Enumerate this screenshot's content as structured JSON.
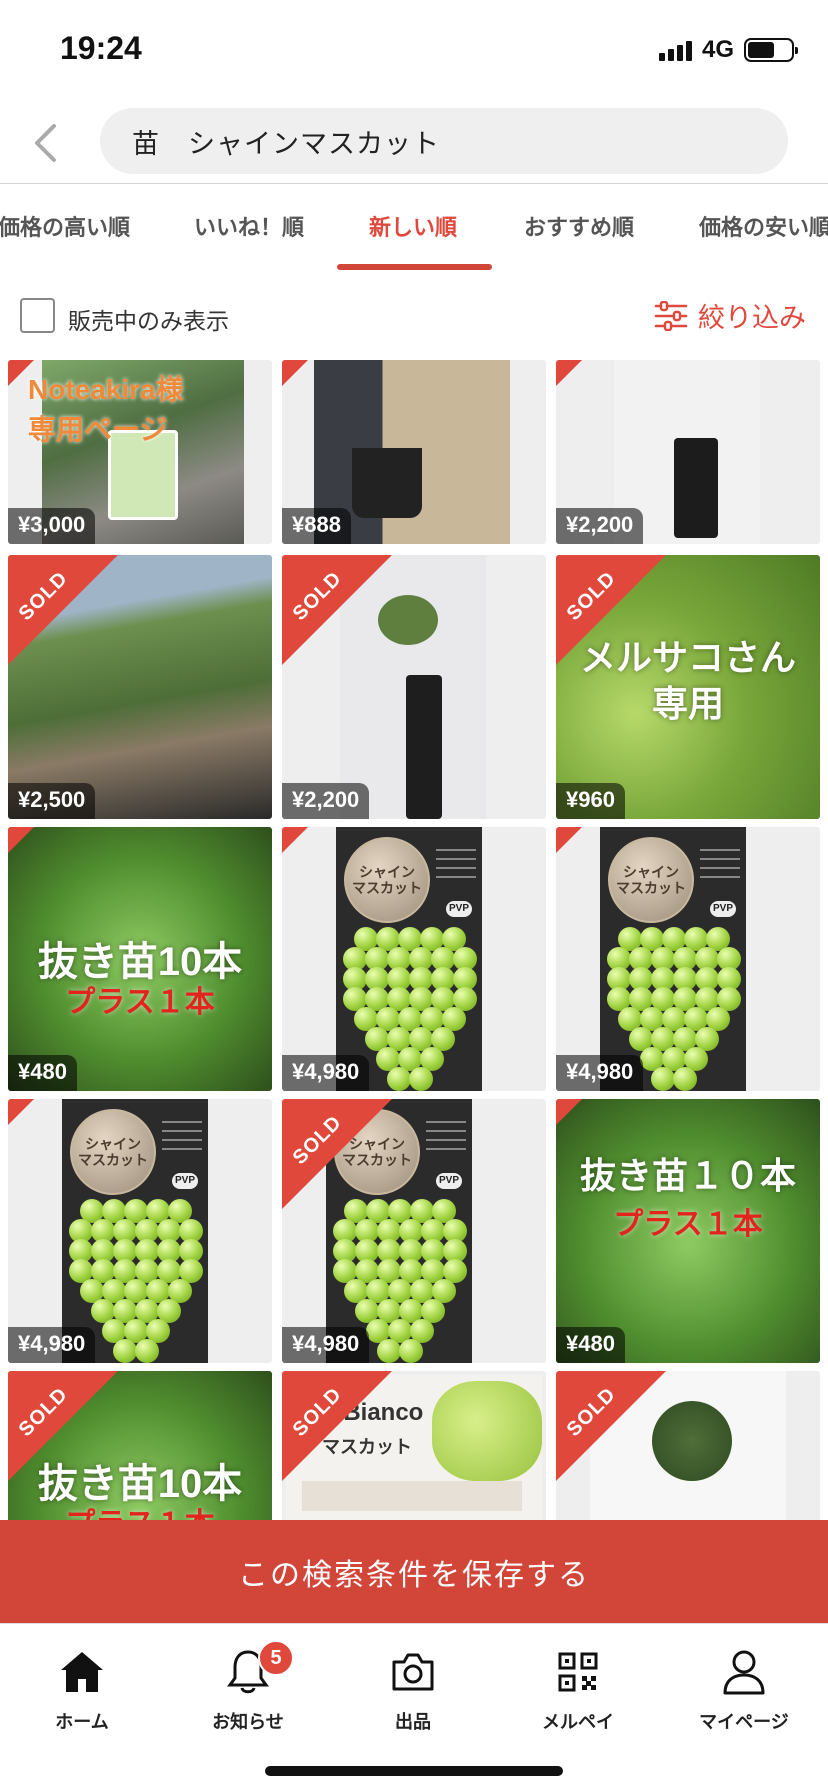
{
  "status_bar": {
    "time": "19:24",
    "network": "4G"
  },
  "search": {
    "query": "苗　シャインマスカット"
  },
  "sort_tabs": [
    "価格の高い順",
    "いいね！順",
    "新しい順",
    "おすすめ順",
    "価格の安い順"
  ],
  "active_sort_tab": "新しい順",
  "filter": {
    "on_sale_only_label": "販売中のみ表示",
    "refine_label": "絞り込み",
    "on_sale_only_checked": false
  },
  "listings": [
    {
      "price": "¥3,000",
      "sold": false,
      "overlay": "Noteakira様\n専用ページ"
    },
    {
      "price": "¥888",
      "sold": false,
      "overlay": ""
    },
    {
      "price": "¥2,200",
      "sold": false,
      "overlay": ""
    },
    {
      "price": "¥2,500",
      "sold": true,
      "overlay": ""
    },
    {
      "price": "¥2,200",
      "sold": true,
      "overlay": ""
    },
    {
      "price": "¥960",
      "sold": true,
      "overlay": "メルサコさん\n専用"
    },
    {
      "price": "¥480",
      "sold": false,
      "overlay": "抜き苗10本",
      "overlay_sub": "プラス１本"
    },
    {
      "price": "¥4,980",
      "sold": false,
      "overlay": ""
    },
    {
      "price": "¥4,980",
      "sold": false,
      "overlay": ""
    },
    {
      "price": "¥4,980",
      "sold": false,
      "overlay": ""
    },
    {
      "price": "¥4,980",
      "sold": true,
      "overlay": ""
    },
    {
      "price": "¥480",
      "sold": false,
      "overlay": "抜き苗１０本",
      "overlay_sub": "プラス１本"
    },
    {
      "price": "",
      "sold": true,
      "overlay": "抜き苗10本",
      "overlay_sub": "プラス１本"
    },
    {
      "price": "",
      "sold": true,
      "overlay": "o Bianco",
      "overlay_sub": "マスカット"
    },
    {
      "price": "",
      "sold": true,
      "overlay": ""
    }
  ],
  "sold_label": "SOLD",
  "grape_label": {
    "title": "シャイン\nマスカット",
    "badge": "PVP"
  },
  "save_search_label": "この検索条件を保存する",
  "bottom_nav": [
    {
      "label": "ホーム",
      "icon": "home-icon"
    },
    {
      "label": "お知らせ",
      "icon": "bell-icon",
      "badge": "5"
    },
    {
      "label": "出品",
      "icon": "camera-icon"
    },
    {
      "label": "メルペイ",
      "icon": "qr-code-icon"
    },
    {
      "label": "マイページ",
      "icon": "person-icon"
    }
  ],
  "colors": {
    "accent": "#d2463a",
    "active_tab": "#e0483c"
  }
}
